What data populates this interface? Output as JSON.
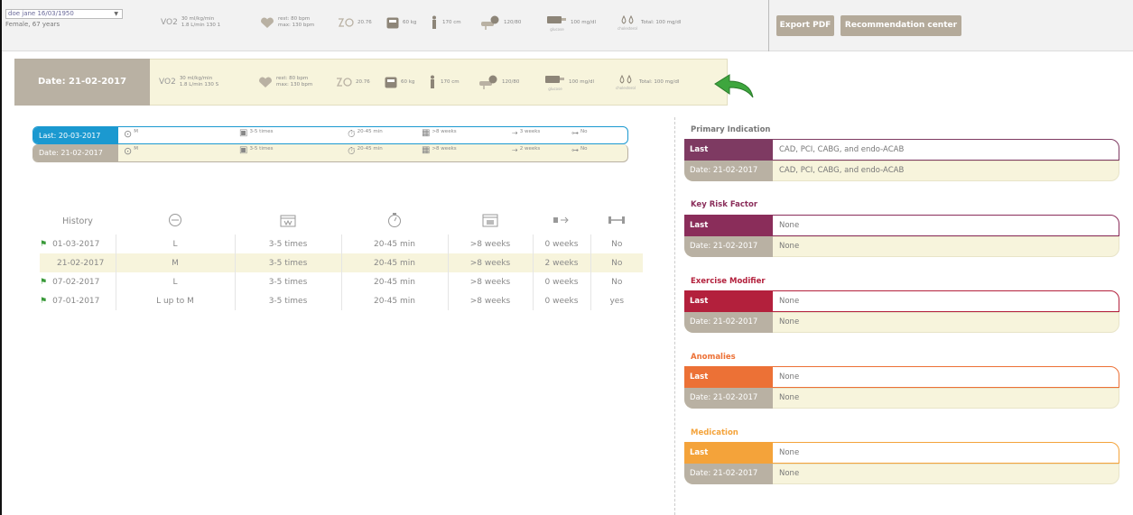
{
  "header": {
    "patient_select": "doe jane 16/03/1950",
    "patient_sub": "Female, 67 years",
    "export_label": "Export PDF",
    "recommend_label": "Recommendation center"
  },
  "metrics": {
    "vo2_label": "VO2",
    "vo2_a": "30 ml/kg/min",
    "vo2_b": "1.8 L/min 130 1",
    "hr_a": "rest: 80 bpm",
    "hr_b": "max: 130 bpm",
    "bmi": "20.76",
    "weight": "60 kg",
    "height": "170 cm",
    "bp": "120/80",
    "glucose": "100 mg/dl",
    "glucose_label": "glucose",
    "cholesterol": "Total: 100 mg/dl",
    "cholesterol_label": "cholesterol"
  },
  "date_row": {
    "label": "Date: 21-02-2017",
    "vo2_b": "1.8 L/min 130 S"
  },
  "compare": [
    {
      "label": "Last: 20-03-2017",
      "intensity": "M",
      "frequency": "3-5 times",
      "duration": "20-45 min",
      "program": ">8 weeks",
      "progression": "3 weeks",
      "resistance": "No"
    },
    {
      "label": "Date: 21-02-2017",
      "intensity": "M",
      "frequency": "3-5 times",
      "duration": "20-45 min",
      "program": ">8 weeks",
      "progression": "2 weeks",
      "resistance": "No"
    }
  ],
  "history": {
    "header": "History",
    "rows": [
      {
        "date": "01-03-2017",
        "intensity": "L",
        "frequency": "3-5 times",
        "duration": "20-45 min",
        "program": ">8 weeks",
        "progression": "0 weeks",
        "resistance": "No"
      },
      {
        "date": "21-02-2017",
        "intensity": "M",
        "frequency": "3-5 times",
        "duration": "20-45 min",
        "program": ">8 weeks",
        "progression": "2 weeks",
        "resistance": "No"
      },
      {
        "date": "07-02-2017",
        "intensity": "L",
        "frequency": "3-5 times",
        "duration": "20-45 min",
        "program": ">8 weeks",
        "progression": "0 weeks",
        "resistance": "No"
      },
      {
        "date": "07-01-2017",
        "intensity": "L up to M",
        "frequency": "3-5 times",
        "duration": "20-45 min",
        "program": ">8 weeks",
        "progression": "0 weeks",
        "resistance": "yes"
      }
    ]
  },
  "sections": [
    {
      "title": "Primary Indication",
      "color": "#7e3a62",
      "last_label": "Last",
      "last_value": "CAD, PCI, CABG, and endo-ACAB",
      "date_label": "Date: 21-02-2017",
      "date_value": "CAD, PCI, CABG, and endo-ACAB"
    },
    {
      "title": "Key Risk Factor",
      "color": "#8a2d5a",
      "last_label": "Last",
      "last_value": "None",
      "date_label": "Date: 21-02-2017",
      "date_value": "None"
    },
    {
      "title": "Exercise Modifier",
      "color": "#b3203c",
      "last_label": "Last",
      "last_value": "None",
      "date_label": "Date: 21-02-2017",
      "date_value": "None"
    },
    {
      "title": "Anomalies",
      "color": "#ec7136",
      "last_label": "Last",
      "last_value": "None",
      "date_label": "Date: 21-02-2017",
      "date_value": "None"
    },
    {
      "title": "Medication",
      "color": "#f4a33a",
      "last_label": "Last",
      "last_value": "None",
      "date_label": "Date: 21-02-2017",
      "date_value": "None"
    }
  ],
  "colors": {
    "last_blue": "#1b99d0",
    "date_beige": "#b9b1a3",
    "highlight": "#f7f4dc",
    "button": "#b4aa9a",
    "arrow": "#3ea63e"
  }
}
